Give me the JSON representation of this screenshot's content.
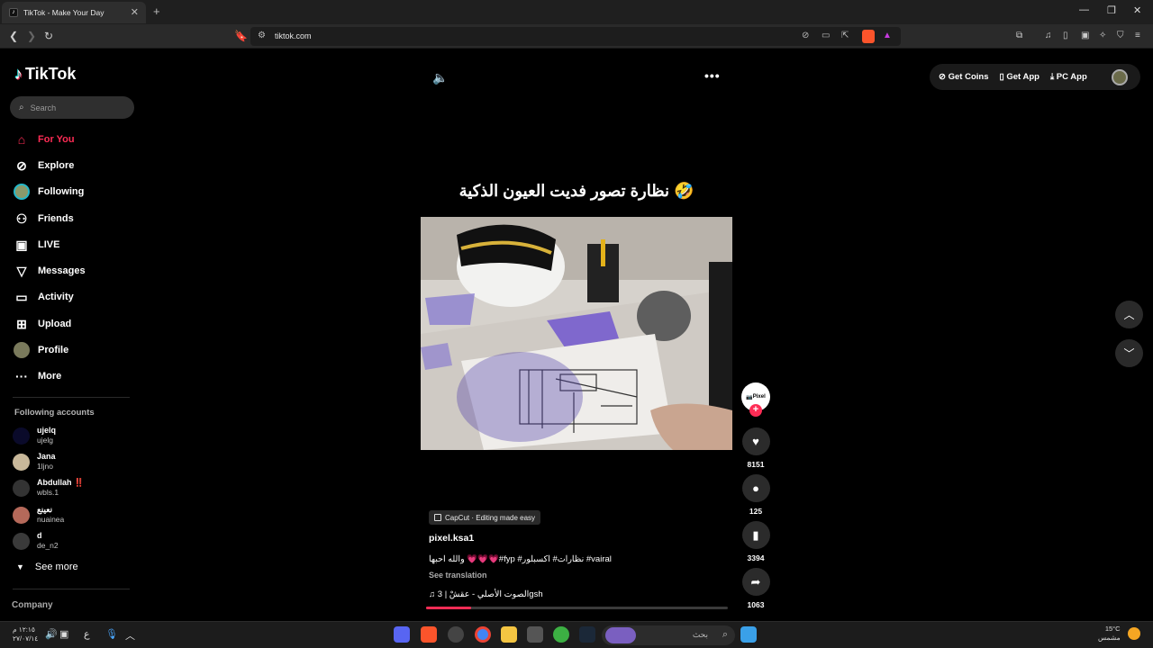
{
  "browser": {
    "tab_title": "TikTok - Make Your Day",
    "url": "tiktok.com"
  },
  "sidebar": {
    "logo": "TikTok",
    "search_placeholder": "Search",
    "nav": [
      {
        "label": "For You",
        "icon": "home-icon"
      },
      {
        "label": "Explore",
        "icon": "compass-icon"
      },
      {
        "label": "Following",
        "icon": "following-avatar-icon"
      },
      {
        "label": "Friends",
        "icon": "friends-icon"
      },
      {
        "label": "LIVE",
        "icon": "live-icon"
      },
      {
        "label": "Messages",
        "icon": "messages-icon"
      },
      {
        "label": "Activity",
        "icon": "activity-icon"
      },
      {
        "label": "Upload",
        "icon": "upload-icon"
      },
      {
        "label": "Profile",
        "icon": "profile-icon"
      },
      {
        "label": "More",
        "icon": "more-icon"
      }
    ],
    "following_title": "Following accounts",
    "accounts": [
      {
        "display": "ujelq",
        "username": "ujelg"
      },
      {
        "display": "Jana",
        "username": "1ljno"
      },
      {
        "display": "Abdullah ‼️",
        "username": "wbls.1"
      },
      {
        "display": "نعينع",
        "username": "nuainea"
      },
      {
        "display": "d",
        "username": "de_n2"
      }
    ],
    "see_more": "See more",
    "company": "Company"
  },
  "top_right": {
    "get_coins": "Get Coins",
    "get_app": "Get App",
    "pc_app": "PC App"
  },
  "video": {
    "title": "نظارة تصور فديت العيون الذكية 🤣",
    "capcut_badge": "CapCut · Editing made easy",
    "author": "pixel.ksa1",
    "description": "والله احبها 💗💗💗#fyp #نظارات# اكسبلور #vairal",
    "see_translation": "See translation",
    "music": "♫  الصوت الأصلي - عقشْ | 3gsh",
    "progress": 0.15
  },
  "actions": {
    "creator_label": "Pixel",
    "likes": "8151",
    "comments": "125",
    "saves": "3394",
    "shares": "1063"
  },
  "taskbar": {
    "time": "١٢:١٥ م",
    "date": "٢٧/٠٧/١٤",
    "lang": "ع",
    "search_placeholder": "بحث",
    "temp": "15°C",
    "weather_text": "مشمس"
  }
}
